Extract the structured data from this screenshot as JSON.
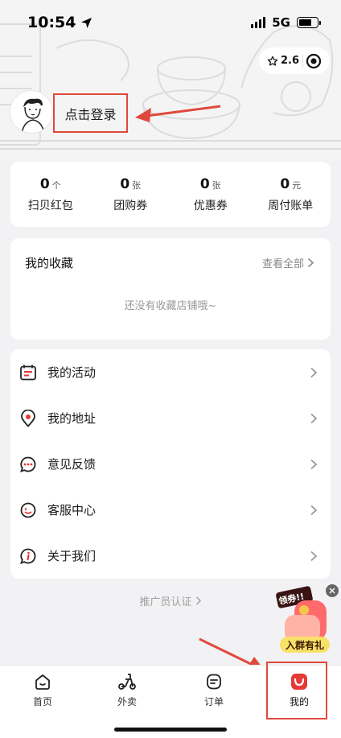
{
  "status_bar": {
    "time": "10:54",
    "network": "5G"
  },
  "header_pill": {
    "rating": "2.6"
  },
  "login": {
    "label": "点击登录"
  },
  "stats": [
    {
      "num": "0",
      "unit": "个",
      "label": "扫贝红包"
    },
    {
      "num": "0",
      "unit": "张",
      "label": "团购券"
    },
    {
      "num": "0",
      "unit": "张",
      "label": "优惠券"
    },
    {
      "num": "0",
      "unit": "元",
      "label": "周付账单"
    }
  ],
  "favorites": {
    "title": "我的收藏",
    "view_all": "查看全部",
    "empty_text": "还没有收藏店铺哦~"
  },
  "menu": [
    {
      "label": "我的活动",
      "icon": "calendar-icon"
    },
    {
      "label": "我的地址",
      "icon": "location-pin-icon"
    },
    {
      "label": "意见反馈",
      "icon": "feedback-bubble-icon"
    },
    {
      "label": "客服中心",
      "icon": "customer-service-icon"
    },
    {
      "label": "关于我们",
      "icon": "info-icon"
    }
  ],
  "promote": {
    "label": "推广员认证"
  },
  "float_ad": {
    "badge_text": "领券!!",
    "tag": "入群有礼"
  },
  "tabbar": [
    {
      "label": "首页",
      "icon": "home-icon"
    },
    {
      "label": "外卖",
      "icon": "delivery-scooter-icon"
    },
    {
      "label": "订单",
      "icon": "orders-icon"
    },
    {
      "label": "我的",
      "icon": "mine-icon"
    }
  ],
  "colors": {
    "accent_red": "#e0483c",
    "menu_icon_red": "#e53935",
    "background": "#f2f2f4"
  }
}
